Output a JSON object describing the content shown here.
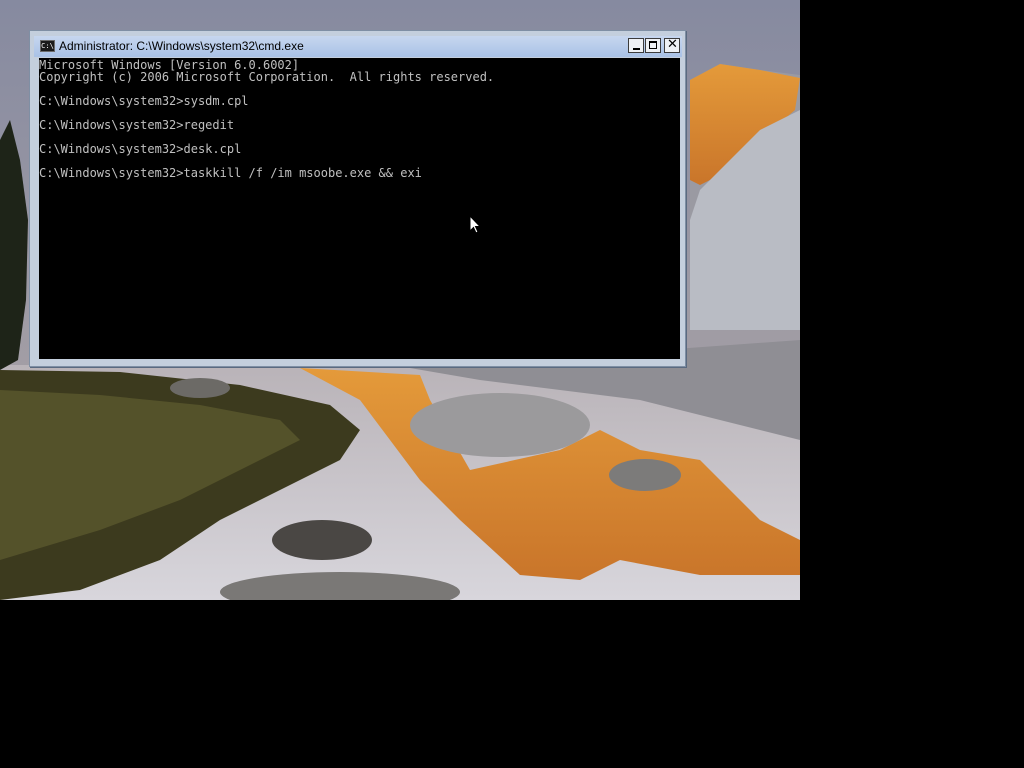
{
  "window": {
    "title": "Administrator: C:\\Windows\\system32\\cmd.exe",
    "icon": "C:\\"
  },
  "console": {
    "lines": [
      "Microsoft Windows [Version 6.0.6002]",
      "Copyright (c) 2006 Microsoft Corporation.  All rights reserved.",
      "",
      "C:\\Windows\\system32>sysdm.cpl",
      "",
      "C:\\Windows\\system32>regedit",
      "",
      "C:\\Windows\\system32>desk.cpl",
      "",
      "C:\\Windows\\system32>taskkill /f /im msoobe.exe && exi"
    ]
  },
  "colors": {
    "console_bg": "#000000",
    "console_fg": "#c0c0c0",
    "frame": "#c4cfdd",
    "titlebar": "#a9c2e6"
  },
  "icons": {
    "window_icon": "cmd-icon",
    "minimize": "minimize-icon",
    "maximize": "maximize-icon",
    "close": "close-icon",
    "cursor": "mouse-pointer-icon"
  }
}
